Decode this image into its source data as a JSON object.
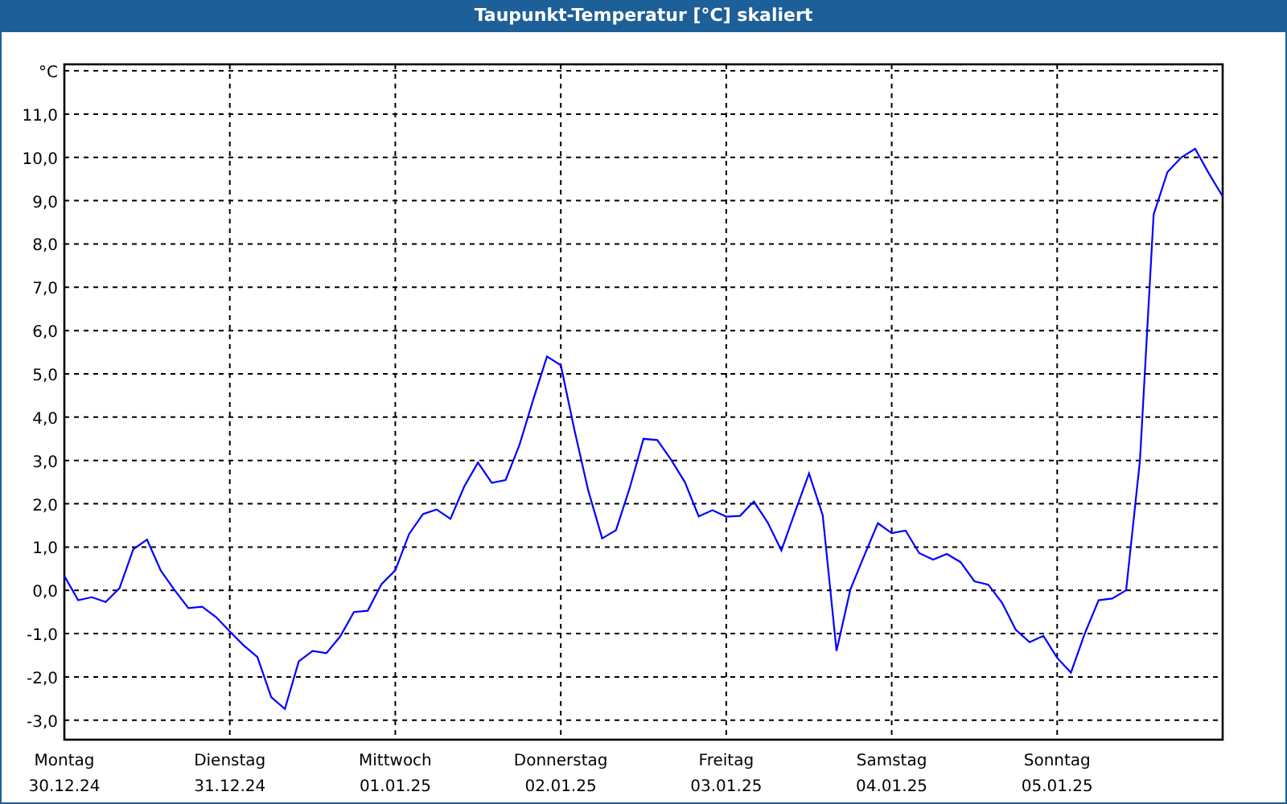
{
  "chart": {
    "title": "Taupunkt-Temperatur [°C] skaliert",
    "chart_data": {
      "type": "line",
      "grid": true,
      "ylabel": "°C",
      "ylim": [
        -3.45,
        12.15
      ],
      "yticks": [
        {
          "value": 11,
          "label": "11,0"
        },
        {
          "value": 10,
          "label": "10,0"
        },
        {
          "value": 9,
          "label": "9,0"
        },
        {
          "value": 8,
          "label": "8,0"
        },
        {
          "value": 7,
          "label": "7,0"
        },
        {
          "value": 6,
          "label": "6,0"
        },
        {
          "value": 5,
          "label": "5,0"
        },
        {
          "value": 4,
          "label": "4,0"
        },
        {
          "value": 3,
          "label": "3,0"
        },
        {
          "value": 2,
          "label": "2,0"
        },
        {
          "value": 1,
          "label": "1,0"
        },
        {
          "value": 0,
          "label": "0,0"
        },
        {
          "value": -1,
          "label": "-1,0"
        },
        {
          "value": -2,
          "label": "-2,0"
        },
        {
          "value": -3,
          "label": "-3,0"
        }
      ],
      "categories": [
        "Montag\n30.12.24",
        null,
        null,
        null,
        null,
        null,
        null,
        null,
        null,
        null,
        null,
        null,
        "Dienstag\n31.12.24",
        null,
        null,
        null,
        null,
        null,
        null,
        null,
        null,
        null,
        null,
        null,
        "Mittwoch\n01.01.25",
        null,
        null,
        null,
        null,
        null,
        null,
        null,
        null,
        null,
        null,
        null,
        "Donnerstag\n02.01.25",
        null,
        null,
        null,
        null,
        null,
        null,
        null,
        null,
        null,
        null,
        null,
        "Freitag\n03.01.25",
        null,
        null,
        null,
        null,
        null,
        null,
        null,
        null,
        null,
        null,
        null,
        "Samstag\n04.01.25",
        null,
        null,
        null,
        null,
        null,
        null,
        null,
        null,
        null,
        null,
        null,
        "Sonntag\n05.01.25",
        null,
        null,
        null,
        null,
        null,
        null,
        null,
        null,
        null,
        null,
        null,
        null
      ],
      "series": [
        {
          "color": "#0000ff",
          "values": [
            0.33,
            -0.23,
            -0.16,
            -0.27,
            0.05,
            0.95,
            1.17,
            0.45,
            0.0,
            -0.41,
            -0.38,
            -0.62,
            -0.95,
            -1.27,
            -1.54,
            -2.47,
            -2.74,
            -1.64,
            -1.4,
            -1.45,
            -1.07,
            -0.5,
            -0.47,
            0.14,
            0.46,
            1.3,
            1.76,
            1.87,
            1.65,
            2.4,
            2.95,
            2.48,
            2.55,
            3.36,
            4.4,
            5.4,
            5.2,
            3.7,
            2.3,
            1.2,
            1.39,
            2.36,
            3.5,
            3.47,
            3.02,
            2.5,
            1.71,
            1.85,
            1.7,
            1.72,
            2.05,
            1.57,
            0.92,
            1.82,
            2.7,
            1.73,
            -1.4,
            0.02,
            0.79,
            1.55,
            1.32,
            1.38,
            0.86,
            0.71,
            0.84,
            0.65,
            0.21,
            0.13,
            -0.29,
            -0.91,
            -1.2,
            -1.05,
            -1.56,
            -1.9,
            -1.0,
            -0.23,
            -0.19,
            0.0,
            3.0,
            8.68,
            9.66,
            10.0,
            10.2,
            9.63,
            9.1
          ]
        }
      ]
    }
  }
}
